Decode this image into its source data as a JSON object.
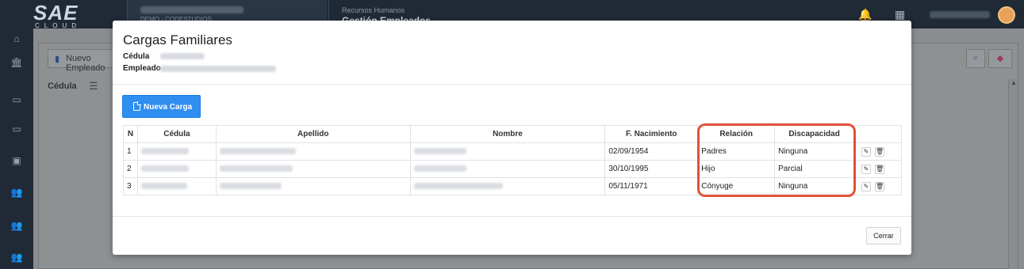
{
  "app": {
    "brand_big": "SAE",
    "brand_small": "CLOUD",
    "company_sub": "DEMO - CODESTUDIOS",
    "module_section": "Recursos Humanos",
    "module_title": "Gestión Empleados"
  },
  "background": {
    "new_employee_button": "Nuevo Empleado",
    "column_header": "Cédula"
  },
  "modal": {
    "title": "Cargas Familiares",
    "cedula_label": "Cédula",
    "empleado_label": "Empleado",
    "new_button_label": "Nueva Carga",
    "close_button_label": "Cerrar",
    "table": {
      "headers": [
        "N",
        "Cédula",
        "Apellido",
        "Nombre",
        "F. Nacimiento",
        "Relación",
        "Discapacidad"
      ],
      "rows": [
        {
          "n": "1",
          "fecha": "02/09/1954",
          "relacion": "Padres",
          "discapacidad": "Ninguna"
        },
        {
          "n": "2",
          "fecha": "30/10/1995",
          "relacion": "Hijo",
          "discapacidad": "Parcial"
        },
        {
          "n": "3",
          "fecha": "05/11/1971",
          "relacion": "Cónyuge",
          "discapacidad": "Ninguna"
        }
      ]
    }
  },
  "colors": {
    "primary_button": "#2f8ef0",
    "highlight_outline": "#e0523a",
    "topbar": "#1f2a36"
  },
  "icons": {
    "new_button_icon": "document-icon",
    "row_edit_icon": "edit-icon",
    "row_delete_icon": "trash-icon"
  }
}
